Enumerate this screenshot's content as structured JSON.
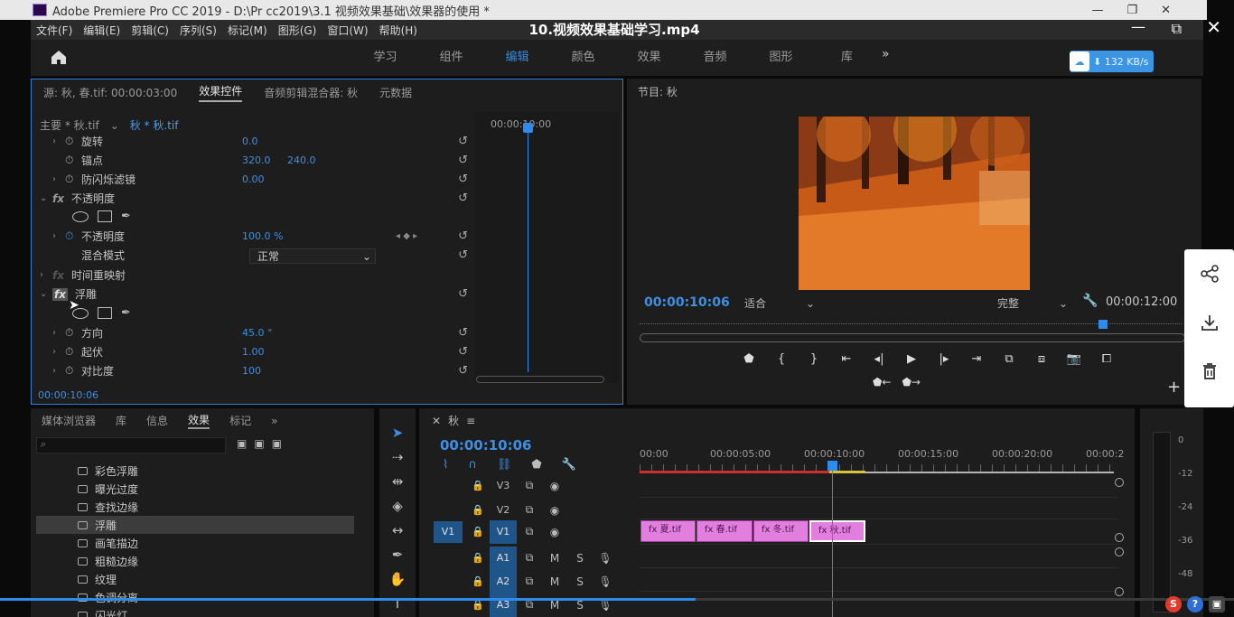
{
  "window": {
    "title": "Adobe Premiere Pro CC 2019 - D:\\Pr cc2019\\3.1 视频效果基础\\效果器的使用 *",
    "overlay_title": "10.视频效果基础学习.mp4"
  },
  "menu": [
    "文件(F)",
    "编辑(E)",
    "剪辑(C)",
    "序列(S)",
    "标记(M)",
    "图形(G)",
    "窗口(W)",
    "帮助(H)"
  ],
  "workspaces": {
    "tabs": [
      "学习",
      "组件",
      "编辑",
      "颜色",
      "效果",
      "音频",
      "图形",
      "库"
    ],
    "active": "编辑",
    "more": "»"
  },
  "speed_badge": {
    "text": "132 KB/s"
  },
  "effect_controls": {
    "tabs": [
      "源: 秋, 春.tif: 00:00:03:00",
      "效果控件",
      "音频剪辑混合器: 秋",
      "元数据"
    ],
    "master": "主要 * 秋.tif",
    "sequence_clip": "秋 * 秋.tif",
    "ruler_time": "00:00:10:00",
    "rows": [
      {
        "label": "旋转",
        "v1": "0.0",
        "v2": ""
      },
      {
        "label": "锚点",
        "v1": "320.0",
        "v2": "240.0"
      },
      {
        "label": "防闪烁滤镜",
        "v1": "0.00",
        "v2": ""
      },
      {
        "label": "不透明度",
        "v1": "",
        "v2": ""
      },
      {
        "label": "不透明度",
        "v1": "100.0 %",
        "v2": ""
      },
      {
        "label": "混合模式",
        "v1": "",
        "v2": ""
      },
      {
        "label": "时间重映射",
        "v1": "",
        "v2": ""
      },
      {
        "label": "浮雕",
        "v1": "",
        "v2": ""
      },
      {
        "label": "方向",
        "v1": "45.0 °",
        "v2": ""
      },
      {
        "label": "起伏",
        "v1": "1.00",
        "v2": ""
      },
      {
        "label": "对比度",
        "v1": "100",
        "v2": ""
      }
    ],
    "blend_mode": "正常",
    "current_time": "00:00:10:06"
  },
  "program_monitor": {
    "title": "节目: 秋",
    "current_time": "00:00:10:06",
    "fit": "适合",
    "quality": "完整",
    "duration": "00:00:12:00",
    "play_position": 0.855
  },
  "project_panel": {
    "tabs": [
      "媒体浏览器",
      "库",
      "信息",
      "效果",
      "标记"
    ],
    "active": "效果",
    "effects": [
      "彩色浮雕",
      "曝光过度",
      "查找边缘",
      "浮雕",
      "画笔描边",
      "粗糙边缘",
      "纹理",
      "色调分离",
      "闪光灯"
    ],
    "selected": "浮雕"
  },
  "timeline": {
    "sequence": "秋",
    "timecode": "00:00:10:06",
    "ruler_labels": [
      "00:00",
      "00:00:05:00",
      "00:00:10:00",
      "00:00:15:00",
      "00:00:20:00",
      "00:00:2"
    ],
    "tracks": [
      {
        "src": "",
        "name": "V3",
        "type": "video"
      },
      {
        "src": "",
        "name": "V2",
        "type": "video"
      },
      {
        "src": "V1",
        "name": "V1",
        "type": "video"
      },
      {
        "src": "",
        "name": "A1",
        "type": "audio"
      },
      {
        "src": "",
        "name": "A2",
        "type": "audio"
      },
      {
        "src": "",
        "name": "A3",
        "type": "audio"
      }
    ],
    "clips": [
      "夏.tif",
      "春.tif",
      "冬.tif",
      "秋.tif"
    ],
    "track_labels": {
      "m": "M",
      "s": "S"
    }
  },
  "meter_labels": [
    "0",
    "-12",
    "-24",
    "-36",
    "-48"
  ],
  "video_progress": 0.564,
  "colors": {
    "accent": "#2d8ceb",
    "clip": "#e27fde",
    "panel": "#1d1d1d"
  }
}
